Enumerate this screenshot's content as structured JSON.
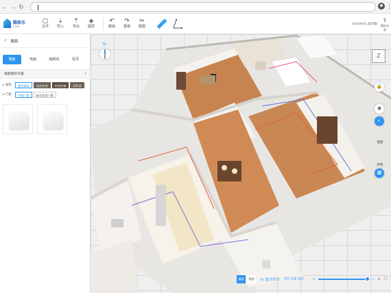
{
  "browser": {
    "back_icon": "arrow-left-icon",
    "forward_icon": "arrow-right-icon",
    "reload_icon": "reload-icon",
    "back_glyph": "←",
    "forward_glyph": "→",
    "reload_glyph": "↻",
    "menu_glyph": "⋮",
    "address_value": ""
  },
  "app": {
    "logo_name": "酷家乐",
    "logo_sub": "kujiale",
    "project_name": "20180816_设计图",
    "share_label": "保存分享",
    "share_glyph": "⇪"
  },
  "toolbar": [
    {
      "name": "file",
      "label": "文件",
      "glyph": "▢"
    },
    {
      "name": "import",
      "label": "导入",
      "glyph": "⇣"
    },
    {
      "name": "export",
      "label": "导出",
      "glyph": "⇡"
    },
    {
      "name": "layers",
      "label": "图层",
      "glyph": "◈"
    },
    {
      "name": "undo",
      "label": "撤销",
      "glyph": "↶"
    },
    {
      "name": "redo",
      "label": "重做",
      "glyph": "↷"
    },
    {
      "name": "screenshot",
      "label": "截图",
      "glyph": "✂"
    },
    {
      "name": "ruler",
      "label": "",
      "glyph": "📏"
    },
    {
      "name": "axis",
      "label": "",
      "glyph": "⟀"
    }
  ],
  "panel": {
    "back_glyph": "<",
    "title": "墙面",
    "tabs": [
      "墙面",
      "地面",
      "踢脚线",
      "吊顶"
    ],
    "active_tab": 0,
    "section_label": "墙面硬装布置",
    "section_caret": "▾",
    "row1": {
      "label": "▸ 墙色",
      "chips": [
        "素色清白",
        "浅灰色调",
        "木纹色调",
        "深色调"
      ],
      "selected": 0
    },
    "row2": {
      "label": "▸ 门套",
      "chips": [
        "平板门套",
        "欧式造型门套"
      ],
      "selected": 0
    }
  },
  "canvas": {
    "compass_label": "N",
    "view_cube_label": "Z",
    "side_buttons": [
      {
        "name": "lock",
        "glyph": "🔒",
        "label": ""
      },
      {
        "name": "visibility",
        "glyph": "◉",
        "label": ""
      },
      {
        "name": "camera",
        "glyph": "◐",
        "label": "",
        "active": true
      },
      {
        "name": "roam",
        "glyph": "",
        "label": "漫游"
      },
      {
        "name": "all",
        "glyph": "",
        "label": "所有"
      },
      {
        "name": "render",
        "glyph": "▦",
        "label": "",
        "active": true
      }
    ],
    "bottom": {
      "btn1": "漫游",
      "btn2": "视频",
      "clock_glyph": "◷",
      "timer_label": "设计时长",
      "timer_value": "00:09:30"
    },
    "zoom": {
      "minus": "−",
      "plus": "+",
      "fullscreen": "⛶",
      "level": 0.86
    }
  }
}
